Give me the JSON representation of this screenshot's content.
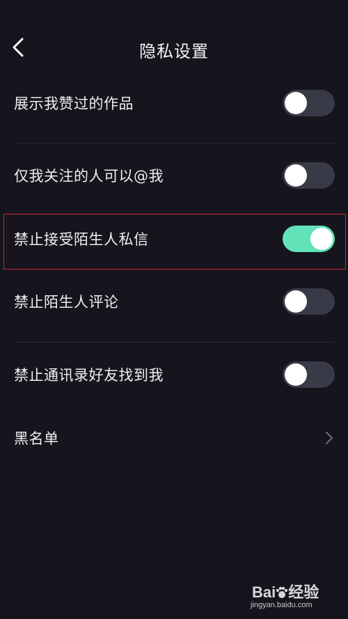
{
  "header": {
    "title": "隐私设置",
    "back_icon": "chevron-left-icon"
  },
  "settings": [
    {
      "label": "展示我赞过的作品",
      "type": "toggle",
      "on": false
    },
    {
      "label": "仅我关注的人可以@我",
      "type": "toggle",
      "on": false
    },
    {
      "label": "禁止接受陌生人私信",
      "type": "toggle",
      "on": true
    },
    {
      "label": "禁止陌生人评论",
      "type": "toggle",
      "on": false
    },
    {
      "label": "禁止通讯录好友找到我",
      "type": "toggle",
      "on": false
    },
    {
      "label": "黑名单",
      "type": "link",
      "icon": "chevron-right-icon"
    }
  ],
  "colors": {
    "background": "#16151d",
    "toggle_off": "#393a47",
    "toggle_on": "#62e2b9",
    "highlight_border": "#c8282b"
  },
  "watermark": {
    "logo": "Bai 经验",
    "url": "jingyan.baidu.com"
  }
}
